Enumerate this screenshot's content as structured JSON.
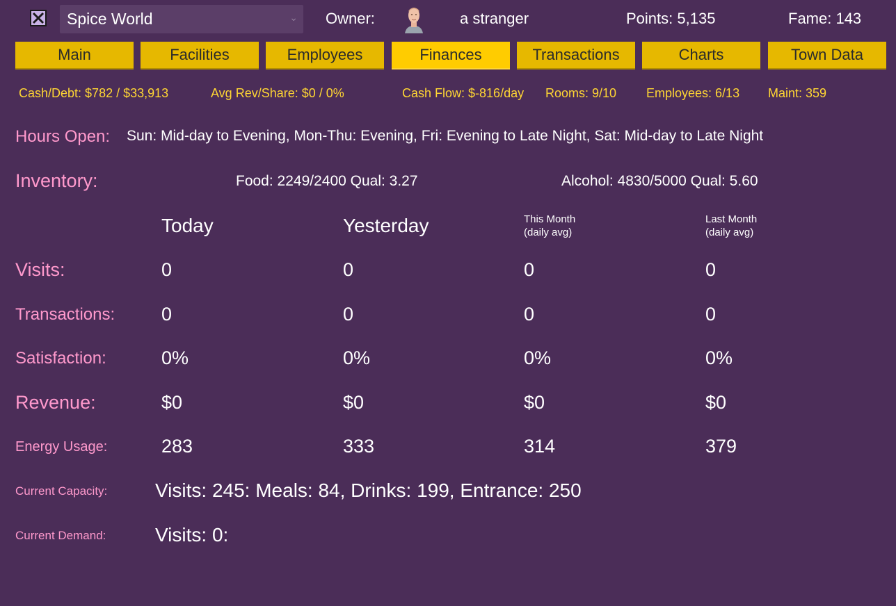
{
  "header": {
    "business_name": "Spice World",
    "owner_label": "Owner:",
    "owner_name": "a stranger",
    "points": "Points: 5,135",
    "fame": "Fame: 143",
    "close_icon": "close-x-icon",
    "dropdown_icon": "chevron-down-icon"
  },
  "tabs": [
    {
      "label": "Main",
      "active": false
    },
    {
      "label": "Facilities",
      "active": false
    },
    {
      "label": "Employees",
      "active": false
    },
    {
      "label": "Finances",
      "active": true
    },
    {
      "label": "Transactions",
      "active": false
    },
    {
      "label": "Charts",
      "active": false
    },
    {
      "label": "Town Data",
      "active": false
    }
  ],
  "stats": {
    "cash_debt": "Cash/Debt: $782 / $33,913",
    "avg_rev": "Avg Rev/Share: $0 / 0%",
    "cash_flow": "Cash Flow: $-816/day",
    "rooms": "Rooms: 9/10",
    "employees": "Employees: 6/13",
    "maint": "Maint: 359"
  },
  "hours": {
    "label": "Hours Open:",
    "value": "Sun: Mid-day to Evening, Mon-Thu: Evening, Fri: Evening to Late Night, Sat: Mid-day to Late Night"
  },
  "inventory": {
    "label": "Inventory:",
    "food": "Food: 2249/2400 Qual: 3.27",
    "alcohol": "Alcohol: 4830/5000 Qual: 5.60"
  },
  "columns": {
    "today": "Today",
    "yesterday": "Yesterday",
    "this_month": "This Month",
    "this_month_sub": "(daily avg)",
    "last_month": "Last Month",
    "last_month_sub": "(daily avg)"
  },
  "rows": [
    {
      "label": "Visits:",
      "values": [
        "0",
        "0",
        "0",
        "0"
      ]
    },
    {
      "label": "Transactions:",
      "values": [
        "0",
        "0",
        "0",
        "0"
      ]
    },
    {
      "label": "Satisfaction:",
      "values": [
        "0%",
        "0%",
        "0%",
        "0%"
      ]
    },
    {
      "label": "Revenue:",
      "values": [
        "$0",
        "$0",
        "$0",
        "$0"
      ]
    },
    {
      "label": "Energy Usage:",
      "values": [
        "283",
        "333",
        "314",
        "379"
      ]
    }
  ],
  "capacity": {
    "label": "Current Capacity:",
    "value": "Visits: 245: Meals: 84, Drinks: 199, Entrance: 250"
  },
  "demand": {
    "label": "Current Demand:",
    "value": "Visits: 0:"
  },
  "colors": {
    "background": "#4b2d58",
    "tab": "#e6b800",
    "tab_active": "#ffcc00",
    "stat_text": "#ffd633",
    "label_pink": "#ff99cc"
  }
}
